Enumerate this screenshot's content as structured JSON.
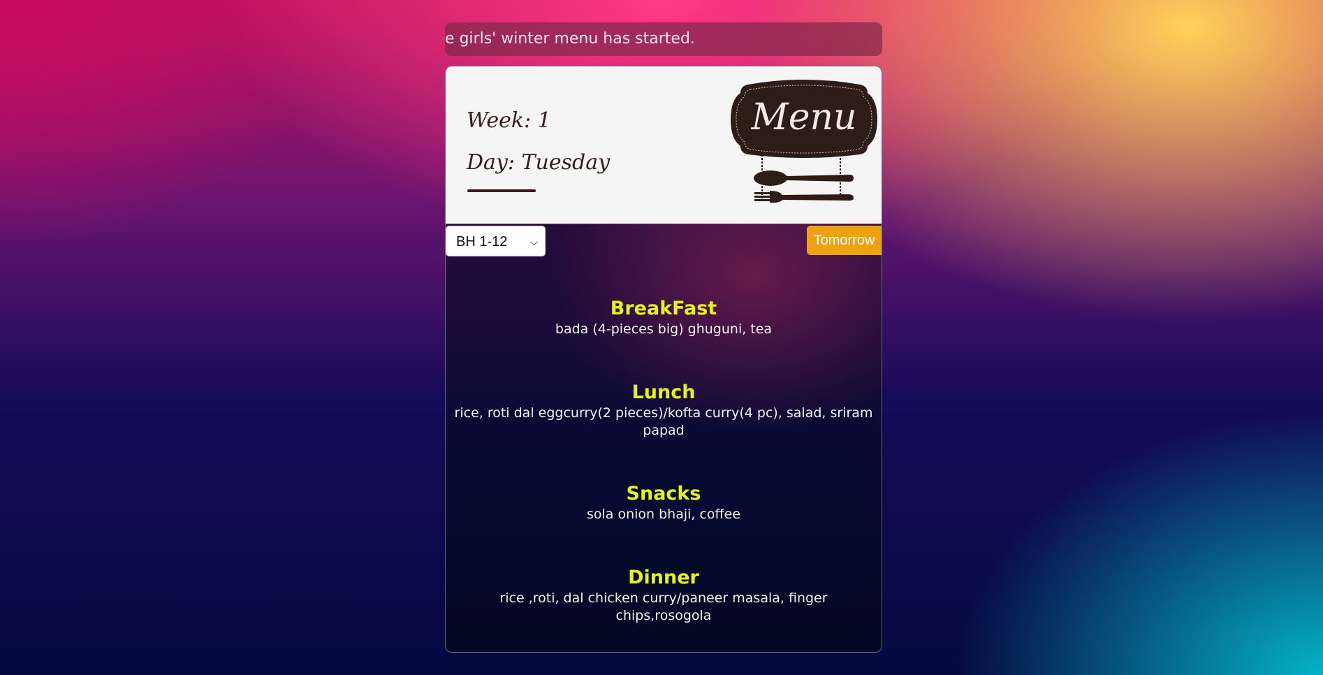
{
  "banner": {
    "text": "he girls' winter menu has started."
  },
  "header": {
    "week": "Week: 1",
    "day": "Day: Tuesday",
    "sign_text": "Menu"
  },
  "controls": {
    "hall_selected": "BH 1-12",
    "tomorrow_label": "Tomorrow"
  },
  "meals": [
    {
      "title": "BreakFast",
      "items": "bada (4-pieces big) ghuguni, tea"
    },
    {
      "title": "Lunch",
      "items": "rice, roti dal eggcurry(2 pieces)/kofta curry(4 pc), salad, sriram papad"
    },
    {
      "title": "Snacks",
      "items": "sola onion bhaji, coffee"
    },
    {
      "title": "Dinner",
      "items": "rice ,roti, dal chicken curry/paneer masala, finger chips,rosogola"
    }
  ],
  "colors": {
    "accent_yellow": "#e6f219",
    "button_orange": "#eea20f",
    "sign_brown": "#2e1c16"
  },
  "icons": [
    "chevron-down-icon",
    "menu-sign-icon",
    "spoon-icon",
    "fork-icon"
  ]
}
